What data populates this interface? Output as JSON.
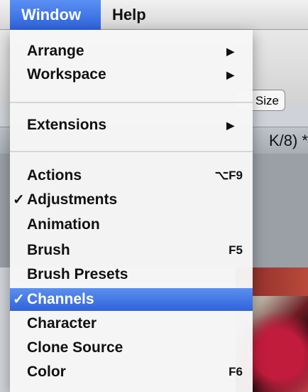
{
  "menubar": {
    "window_label": "Window",
    "help_label": "Help"
  },
  "background": {
    "fit_size_label": "Size",
    "doc_tab_text": "K/8) *"
  },
  "menu": {
    "items": [
      {
        "label": "Arrange",
        "submenu": true
      },
      {
        "label": "Workspace",
        "submenu": true
      },
      {
        "label": "Extensions",
        "submenu": true
      },
      {
        "label": "Actions",
        "shortcut": "⌥F9"
      },
      {
        "label": "Adjustments",
        "checked": true
      },
      {
        "label": "Animation"
      },
      {
        "label": "Brush",
        "shortcut": "F5"
      },
      {
        "label": "Brush Presets"
      },
      {
        "label": "Channels",
        "checked": true,
        "selected": true
      },
      {
        "label": "Character"
      },
      {
        "label": "Clone Source"
      },
      {
        "label": "Color",
        "shortcut": "F6"
      }
    ],
    "check_glyph": "✓",
    "arrow_glyph": "▶"
  },
  "icons": {
    "submenu": "triangle-right-icon",
    "check": "checkmark-icon"
  },
  "colors": {
    "highlight": "#2f63d9",
    "menu_bg": "#f6f6f6"
  }
}
